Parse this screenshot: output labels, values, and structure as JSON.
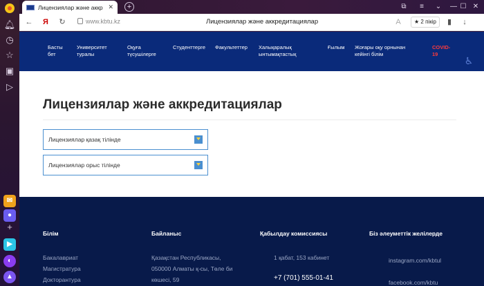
{
  "browser": {
    "tab_title": "Лицензиялар және аккр",
    "tab_close": "✕",
    "new_tab": "+",
    "url": "www.kbtu.kz",
    "page_title": "Лицензиялар және аккредитациялар",
    "review_label": "2 пікір",
    "window_controls": [
      "⧉",
      "≡",
      "⌄",
      "—",
      "☐",
      "✕"
    ]
  },
  "sidebar_icons": [
    "yandex-logo",
    "bell-icon",
    "clock-icon",
    "star-icon",
    "collections-icon",
    "play-icon",
    "mail-app",
    "messenger-app",
    "add-icon",
    "video-app",
    "alice-app",
    "assistant-app"
  ],
  "nav": {
    "items": [
      {
        "label": "Басты\nбет"
      },
      {
        "label": "Университет\nтуралы"
      },
      {
        "label": "Оқуға\nтүсушілерге"
      },
      {
        "label": "Студенттерге"
      },
      {
        "label": "Факультеттер"
      },
      {
        "label": "Халықаралық\nынтымақтастық"
      },
      {
        "label": "Ғылым"
      },
      {
        "label": "Жоғары оқу орнынан\nкейінгі білім"
      },
      {
        "label": "COVID-\n19"
      }
    ]
  },
  "main": {
    "heading": "Лицензиялар және аккредитациялар",
    "items": [
      {
        "label": "Лицензиялар қазақ тілінде"
      },
      {
        "label": "Лицензиялар орыс тілінде"
      }
    ]
  },
  "footer": {
    "col1": {
      "title": "Білім",
      "links": [
        "Бакалавриат",
        "Магистратура",
        "Докторантура"
      ]
    },
    "col2": {
      "title": "Байланыс",
      "lines": [
        "Қазақстан Республикасы,",
        "050000 Алматы қ-сы, Төле би",
        "көшесі, 59"
      ]
    },
    "col3": {
      "title": "Қабылдау комиссиясы",
      "room": "1 қабат, 153 кабинет",
      "phone": "+7 (701) 555-01-41"
    },
    "col4": {
      "title": "Біз әлеуметтік желілерде",
      "links": [
        "instagram.com/kbtul",
        "facebook.com/kbtu"
      ]
    }
  },
  "colors": {
    "nav_bg": "#0a2a7a",
    "footer_bg": "#081a4a",
    "accent": "#4a8fd0",
    "covid": "#ff3b3b"
  }
}
